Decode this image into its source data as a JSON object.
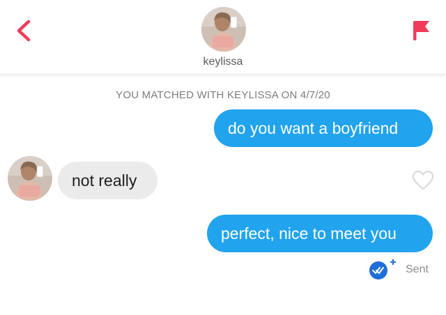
{
  "header": {
    "name": "keylissa",
    "back_icon": "chevron-left-icon",
    "report_icon": "flag-icon"
  },
  "match_banner": "YOU MATCHED WITH KEYLISSA ON 4/7/20",
  "messages": [
    {
      "from": "me",
      "text": "do you want a boyfriend"
    },
    {
      "from": "them",
      "text": "not really"
    },
    {
      "from": "me",
      "text": "perfect, nice to meet you"
    }
  ],
  "status": {
    "label": "Sent"
  },
  "colors": {
    "accent_red": "#f03b5a",
    "sent_bubble": "#21a3ee",
    "received_bubble": "#ebebeb",
    "receipt_blue": "#1e6fd9"
  }
}
